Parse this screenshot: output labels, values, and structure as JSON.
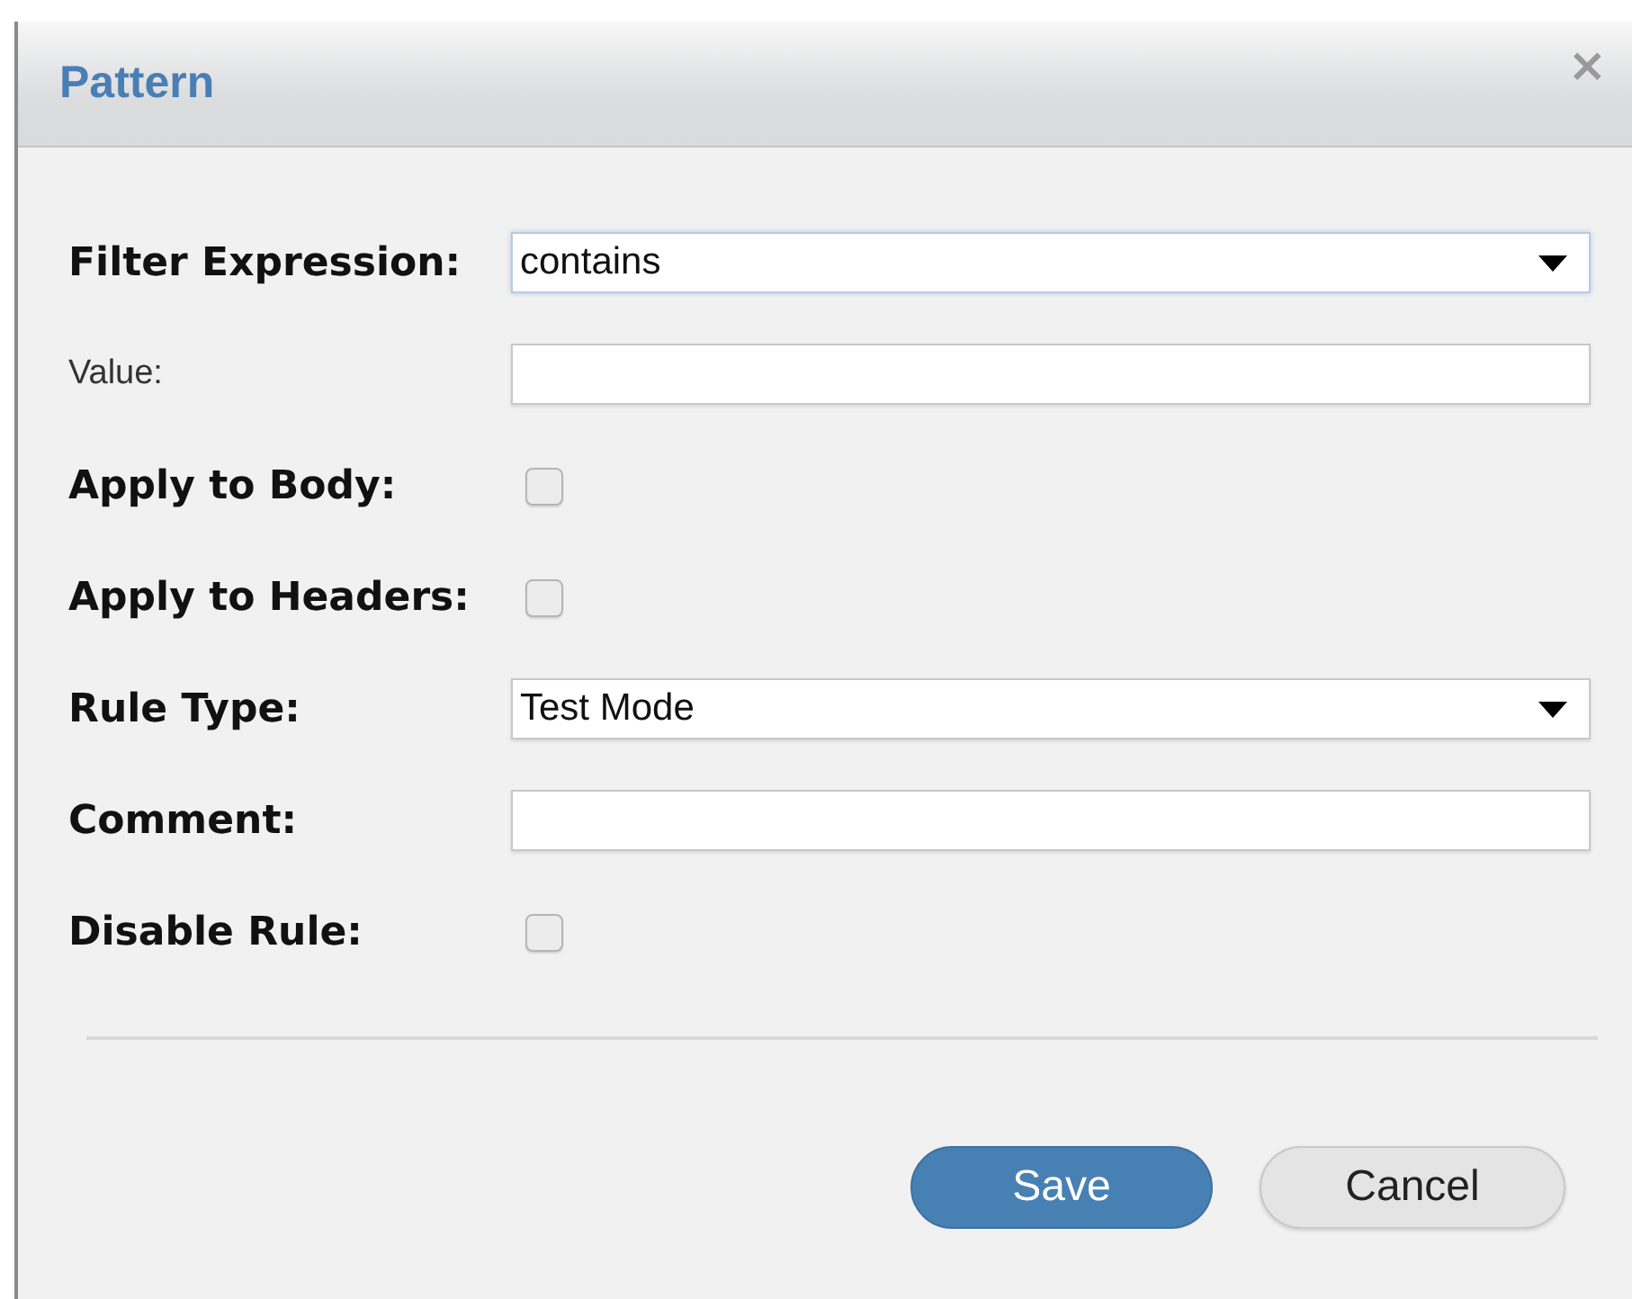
{
  "dialog": {
    "title": "Pattern",
    "close": "×"
  },
  "fields": [
    {
      "kind": "select",
      "label": "Filter Expression:",
      "bold": true,
      "value": "contains",
      "focused": true
    },
    {
      "kind": "text",
      "label": "Value:",
      "bold": false,
      "focused": false
    },
    {
      "kind": "checkbox",
      "label": "Apply to Body:",
      "bold": true,
      "checked": false
    },
    {
      "kind": "checkbox",
      "label": "Apply to Headers:",
      "bold": true,
      "checked": false
    },
    {
      "kind": "select",
      "label": "Rule Type:",
      "bold": true,
      "value": "Test Mode",
      "focused": false
    },
    {
      "kind": "text",
      "label": "Comment:",
      "bold": true,
      "focused": false
    },
    {
      "kind": "checkbox",
      "label": "Disable Rule:",
      "bold": true,
      "checked": false
    }
  ],
  "buttons": [
    {
      "label": "Save",
      "primary": true
    },
    {
      "label": "Cancel",
      "primary": false
    }
  ]
}
